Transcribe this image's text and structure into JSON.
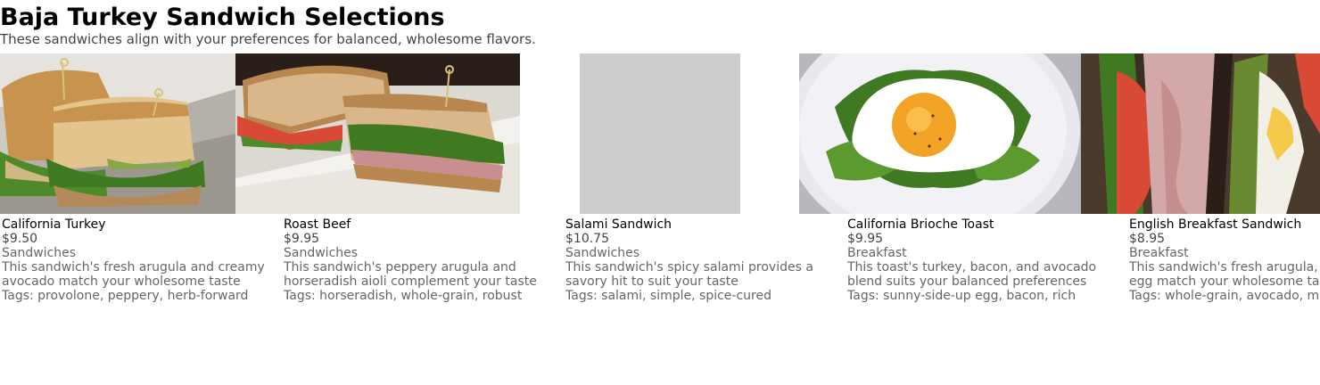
{
  "header": {
    "title": "Baja Turkey Sandwich Selections",
    "subtitle": "These sandwiches align with your preferences for balanced, wholesome flavors."
  },
  "colors": {
    "placeholder": "#cccccc",
    "subtitle_text": "#444444",
    "meta_text": "#666666"
  },
  "items": [
    {
      "name": "California Turkey",
      "price": "$9.50",
      "category": "Sandwiches",
      "description": "This sandwich's fresh arugula and creamy avocado match your wholesome taste",
      "tags": "Tags: provolone, peppery, herb-forward",
      "image": "ciabatta-turkey-sandwich-photo"
    },
    {
      "name": "Roast Beef",
      "price": "$9.95",
      "category": "Sandwiches",
      "description": "This sandwich's peppery arugula and horseradish aioli complement your taste",
      "tags": "Tags: horseradish, whole-grain, robust",
      "image": "roast-beef-sandwich-photo"
    },
    {
      "name": "Salami Sandwich",
      "price": "$10.75",
      "category": "Sandwiches",
      "description": "This sandwich's spicy salami provides a savory hit to suit your taste",
      "tags": "Tags: salami, simple, spice-cured",
      "image": "image-placeholder"
    },
    {
      "name": "California Brioche Toast",
      "price": "$9.95",
      "category": "Breakfast",
      "description": "This toast's turkey, bacon, and avocado blend suits your balanced preferences",
      "tags": "Tags: sunny-side-up egg, bacon, rich",
      "image": "fried-egg-toast-photo"
    },
    {
      "name": "English Breakfast Sandwich",
      "price": "$8.95",
      "category": "Breakfast",
      "description": "This sandwich's fresh arugula, avocado, and egg match your wholesome taste",
      "tags": "Tags: whole-grain, avocado, mild",
      "image": "breakfast-sandwich-photo"
    }
  ]
}
